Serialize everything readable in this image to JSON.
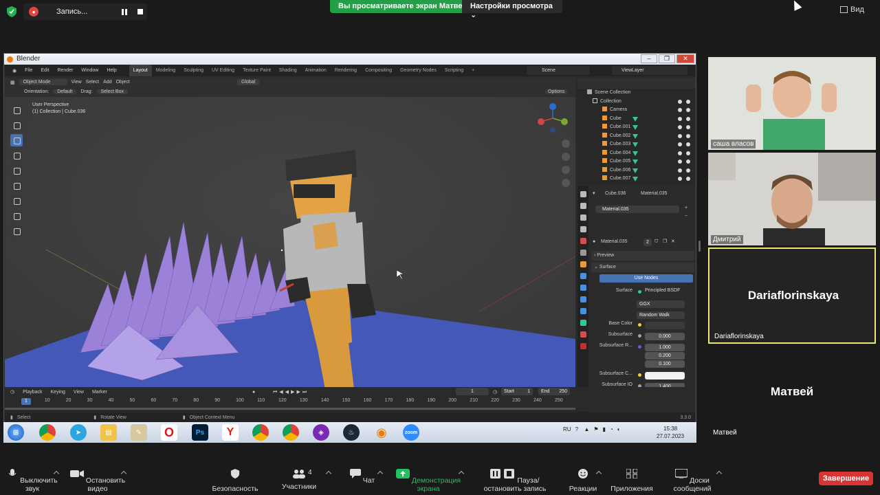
{
  "zoom_top": {
    "recording_label": "Запись...",
    "viewing_banner": "Вы просматриваете экран Матвей",
    "view_settings": "Настройки просмотра",
    "view_button": "Вид"
  },
  "blender": {
    "window_title": "Blender",
    "menus": [
      "File",
      "Edit",
      "Render",
      "Window",
      "Help"
    ],
    "workspaces": [
      "Layout",
      "Modeling",
      "Sculpting",
      "UV Editing",
      "Texture Paint",
      "Shading",
      "Animation",
      "Rendering",
      "Compositing",
      "Geometry Nodes",
      "Scripting"
    ],
    "active_workspace": "Layout",
    "scene": "Scene",
    "view_layer": "ViewLayer",
    "viewport": {
      "mode": "Object Mode",
      "header_menus": [
        "View",
        "Select",
        "Add",
        "Object"
      ],
      "orientation_label": "Orientation:",
      "orientation_value": "Default",
      "drag_label": "Drag:",
      "drag_value": "Select Box",
      "transform": "Global",
      "options": "Options",
      "info_line1": "User Perspective",
      "info_line2": "(1) Collection | Cube.036"
    },
    "outliner": {
      "scene_collection": "Scene Collection",
      "collection": "Collection",
      "items": [
        "Camera",
        "Cube",
        "Cube.001",
        "Cube.002",
        "Cube.003",
        "Cube.004",
        "Cube.005",
        "Cube.006",
        "Cube.007"
      ]
    },
    "properties": {
      "object": "Cube.036",
      "material": "Material.035",
      "slot": "Material.035",
      "material_users": "2",
      "preview": "Preview",
      "surface_section": "Surface",
      "use_nodes": "Use Nodes",
      "surface_label": "Surface",
      "surface_value": "Principled BSDF",
      "distribution": "GGX",
      "subsurface_method": "Random Walk",
      "base_color_label": "Base Color",
      "subsurface_label": "Subsurface",
      "subsurface_value": "0.000",
      "subsurface_r_label": "Subsurface R...",
      "subsurface_r": [
        "1.000",
        "0.200",
        "0.100"
      ],
      "subsurface_c_label": "Subsurface C...",
      "subsurface_ior_label": "Subsurface IO",
      "subsurface_ior": "1.400"
    },
    "timeline": {
      "menus": [
        "Playback",
        "Keying",
        "View",
        "Marker"
      ],
      "current_frame": "1",
      "start_label": "Start",
      "start": "1",
      "end_label": "End",
      "end": "250",
      "ticks": [
        "1",
        "10",
        "20",
        "30",
        "40",
        "50",
        "60",
        "70",
        "80",
        "90",
        "100",
        "110",
        "120",
        "130",
        "140",
        "150",
        "160",
        "170",
        "180",
        "190",
        "200",
        "210",
        "220",
        "230",
        "240",
        "250"
      ]
    },
    "status": {
      "select": "Select",
      "rotate": "Rotate View",
      "context": "Object Context Menu",
      "version": "3.3.0"
    }
  },
  "taskbar": {
    "lang": "RU",
    "time": "15:38",
    "date": "27.07.2023",
    "zoom_label": "zoom"
  },
  "participants": [
    {
      "name": "саша власов"
    },
    {
      "name": "Дмитрий"
    },
    {
      "name": "Dariaflorinskaya",
      "center": "Dariaflorinskaya"
    },
    {
      "name": "Матвей",
      "center": "Матвей"
    }
  ],
  "zoom_bottom": {
    "mute": "Выключить звук",
    "video": "Остановить видео",
    "security": "Безопасность",
    "participants_count": "4",
    "participants": "Участники",
    "chat": "Чат",
    "share": "Демонстрация экрана",
    "pause_rec": "Пауза/остановить запись",
    "reactions": "Реакции",
    "apps": "Приложения",
    "whiteboards": "Доски сообщений",
    "end": "Завершение"
  },
  "colors": {
    "zoom_green": "#23a047",
    "zoom_red": "#d93434",
    "blender_blue": "#4772b3",
    "active_speaker": "#e8e870"
  }
}
